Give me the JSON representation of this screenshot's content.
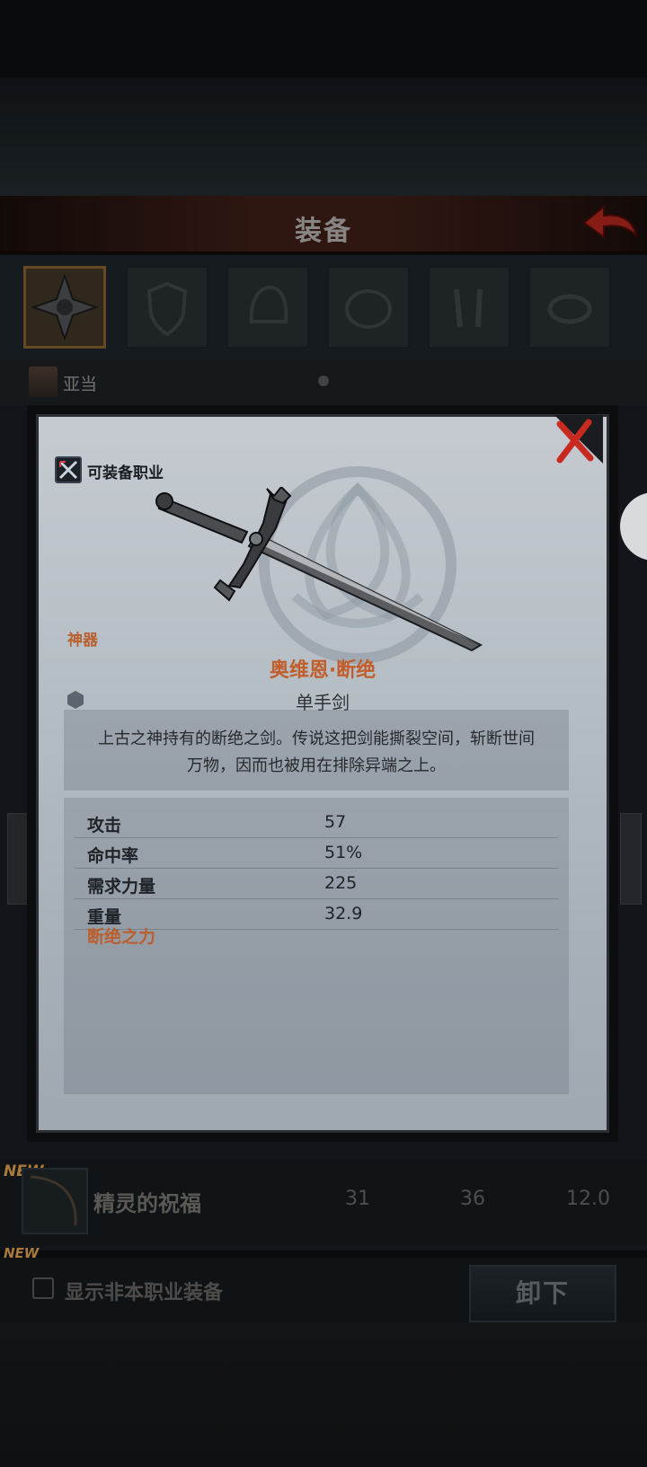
{
  "header": {
    "title": "装备"
  },
  "character": {
    "name": "亚当"
  },
  "detail": {
    "class_label": "可装备职业",
    "rarity": "神器",
    "item_name": "奥维恩·断绝",
    "item_type": "单手剑",
    "description": "上古之神持有的断绝之剑。传说这把剑能撕裂空间，斩断世间万物，因而也被用在排除异端之上。",
    "stats": [
      {
        "label": "攻击",
        "value": "57"
      },
      {
        "label": "命中率",
        "value": "51%"
      },
      {
        "label": "需求力量",
        "value": "225"
      },
      {
        "label": "重量",
        "value": "32.9"
      }
    ],
    "special": "断绝之力"
  },
  "list": {
    "new_tag": "NEW",
    "items": [
      {
        "name": "精灵的祝福",
        "v1": "31",
        "v2": "36",
        "v3": "12.0"
      }
    ],
    "new_tag_2": "NEW"
  },
  "footer": {
    "show_other_class": "显示非本职业装备",
    "unequip_label": "卸下"
  },
  "colors": {
    "accent_orange": "#c15e2c",
    "title_bar": "#3a1c15",
    "panel": "#b7bfc6"
  }
}
